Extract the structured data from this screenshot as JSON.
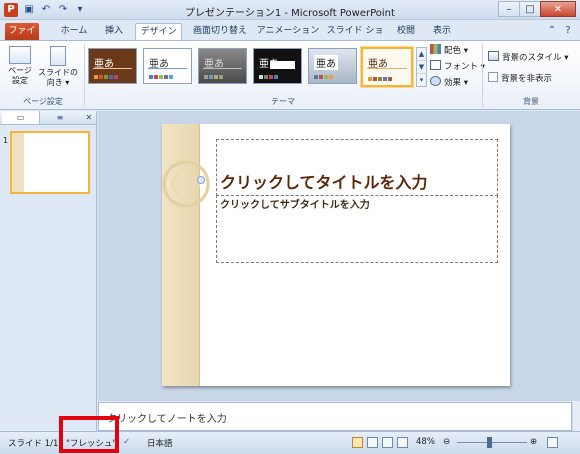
{
  "window": {
    "title": "プレゼンテーション1 - Microsoft PowerPoint",
    "app_icon_label": "P"
  },
  "tabs": [
    {
      "label": "ファイル"
    },
    {
      "label": "ホーム"
    },
    {
      "label": "挿入"
    },
    {
      "label": "デザイン"
    },
    {
      "label": "画面切り替え"
    },
    {
      "label": "アニメーション"
    },
    {
      "label": "スライド ショー"
    },
    {
      "label": "校閲"
    },
    {
      "label": "表示"
    }
  ],
  "active_tab": "デザイン",
  "ribbon": {
    "page_setup": {
      "label_line1": "ページ",
      "label_line2": "設定"
    },
    "orientation": {
      "label_line1": "スライドの",
      "label_line2": "向き ▾"
    },
    "page_setup_group": "ページ設定",
    "themes_group": "テーマ",
    "theme_sample_text": "亜あ",
    "colors": "配色 ▾",
    "fonts": "フォント ▾",
    "effects": "効果 ▾",
    "background_styles": "背景のスタイル ▾",
    "hide_background": "背景を非表示",
    "background_group": "背景"
  },
  "slide_pane": {
    "slide_number": "1"
  },
  "slide": {
    "title_placeholder": "クリックしてタイトルを入力",
    "subtitle_placeholder": "クリックしてサブタイトルを入力"
  },
  "notes": {
    "placeholder": "クリックしてノートを入力"
  },
  "status": {
    "slide_counter": "スライド 1/1",
    "theme_name": "\"フレッシュ\"",
    "language": "日本語",
    "zoom": "48%"
  },
  "colors": {
    "file_tab": "#c8441f",
    "selection_highlight": "#e3000f",
    "title_text": "#5a2a0c"
  }
}
